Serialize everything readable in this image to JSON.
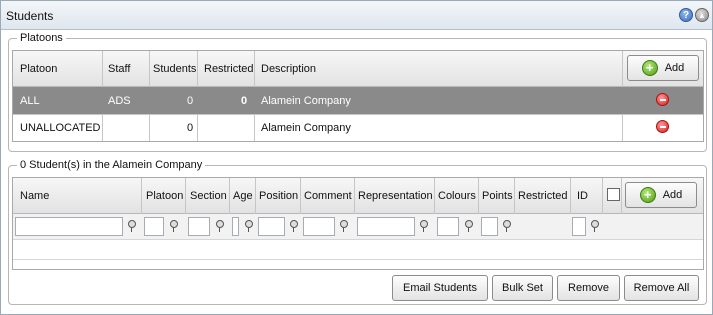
{
  "window": {
    "title": "Students",
    "help_icon": "help-icon",
    "collapse_icon": "collapse-up-icon"
  },
  "platoons": {
    "legend": "Platoons",
    "columns": [
      "Platoon",
      "Staff",
      "Students",
      "Restricted",
      "Description"
    ],
    "add_label": "Add",
    "rows": [
      {
        "platoon": "ALL",
        "staff": "ADS",
        "students": "0",
        "restricted": "0",
        "description": "Alamein Company",
        "selected": true
      },
      {
        "platoon": "UNALLOCATED",
        "staff": "",
        "students": "0",
        "restricted": "",
        "description": "Alamein Company",
        "selected": false
      }
    ]
  },
  "students": {
    "legend": "0 Student(s) in the Alamein Company",
    "columns": [
      "Name",
      "Platoon",
      "Section",
      "Age",
      "Position",
      "Comment",
      "Representation",
      "Colours",
      "Points",
      "Restricted",
      "ID"
    ],
    "add_label": "Add"
  },
  "actions": {
    "email": "Email Students",
    "bulk": "Bulk Set",
    "remove": "Remove",
    "remove_all": "Remove All"
  },
  "colors": {
    "selected_row": "#8a8a8a",
    "accent_add": "#4f9a14",
    "remove_red": "#d41f1f"
  }
}
